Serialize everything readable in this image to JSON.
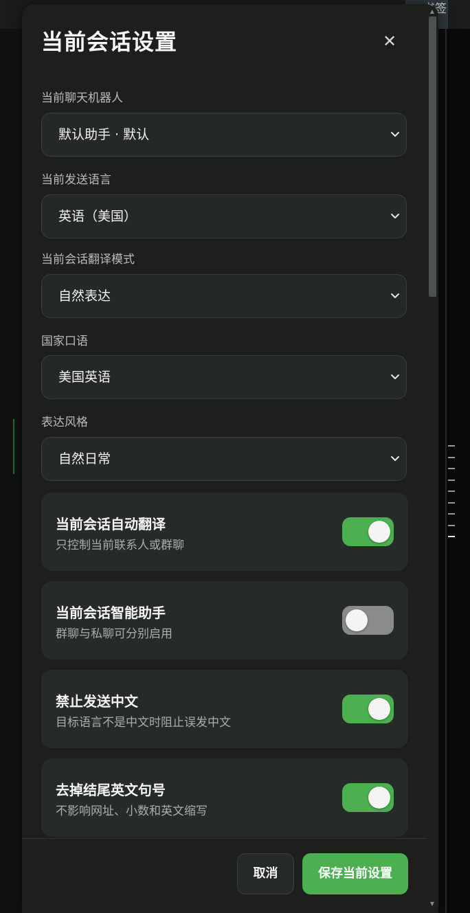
{
  "background": {
    "tab_label": "书签",
    "accent_color": "#4caf50"
  },
  "modal": {
    "title": "当前会话设置",
    "close_icon": "close-icon",
    "fields": [
      {
        "label": "当前聊天机器人",
        "value": "默认助手 · 默认"
      },
      {
        "label": "当前发送语言",
        "value": "英语（美国）"
      },
      {
        "label": "当前会话翻译模式",
        "value": "自然表达"
      },
      {
        "label": "国家口语",
        "value": "美国英语"
      },
      {
        "label": "表达风格",
        "value": "自然日常"
      }
    ],
    "toggles": [
      {
        "title": "当前会话自动翻译",
        "subtitle": "只控制当前联系人或群聊",
        "on": true
      },
      {
        "title": "当前会话智能助手",
        "subtitle": "群聊与私聊可分别启用",
        "on": false
      },
      {
        "title": "禁止发送中文",
        "subtitle": "目标语言不是中文时阻止误发中文",
        "on": true
      },
      {
        "title": "去掉结尾英文句号",
        "subtitle": "不影响网址、小数和英文缩写",
        "on": true
      }
    ],
    "buttons": {
      "cancel": "取消",
      "save": "保存当前设置"
    }
  }
}
